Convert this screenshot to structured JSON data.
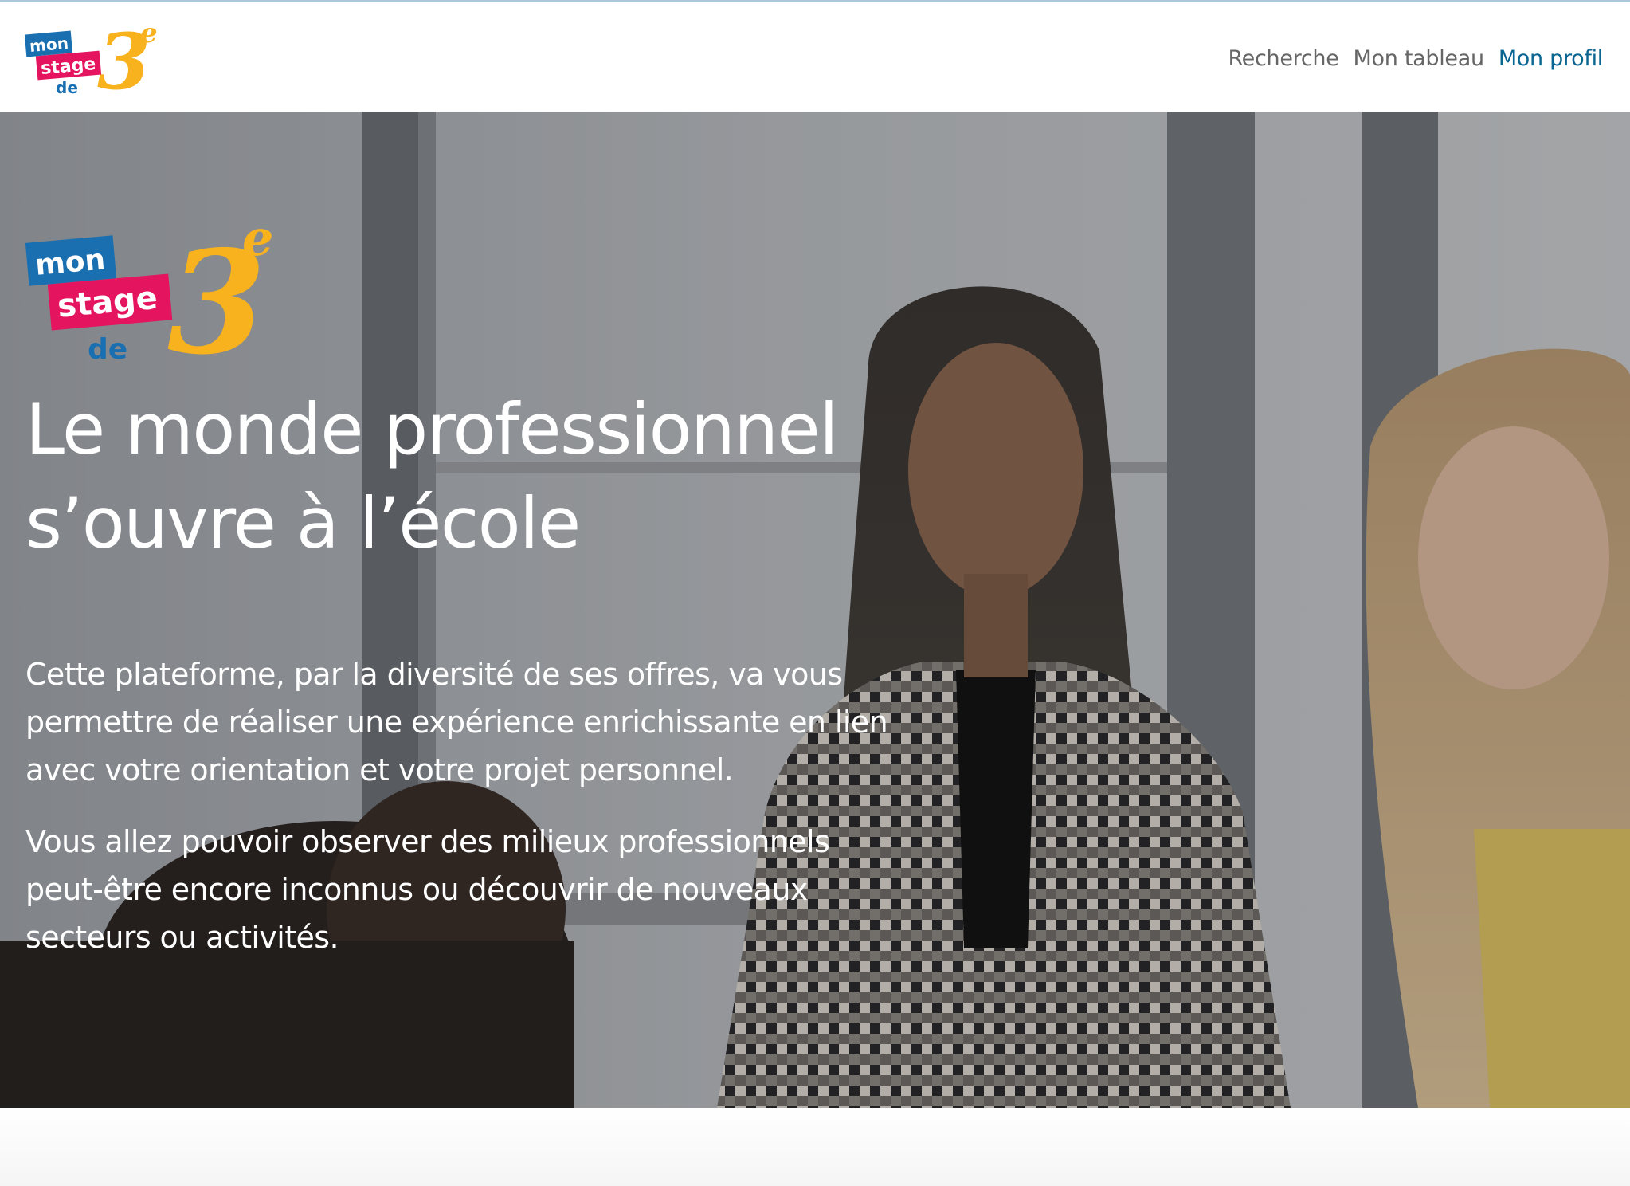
{
  "header": {
    "logo": {
      "line1": "mon",
      "line2": "stage",
      "line3": "de",
      "numeral": "3",
      "superscript": "e"
    },
    "nav": [
      {
        "label": "Recherche",
        "active": false
      },
      {
        "label": "Mon tableau",
        "active": false
      },
      {
        "label": "Mon profil",
        "active": true
      }
    ]
  },
  "hero": {
    "logo": {
      "line1": "mon",
      "line2": "stage",
      "line3": "de",
      "numeral": "3",
      "superscript": "e"
    },
    "title_lines": [
      "Le monde professionnel",
      "s’ouvre à l’école"
    ],
    "paragraph1_lines": [
      "Cette plateforme, par la diversité de ses offres, va vous",
      "permettre de réaliser une expérience enrichissante en lien",
      "avec votre orientation et votre projet personnel."
    ],
    "paragraph2_lines": [
      "Vous allez pouvoir observer des milieux professionnels",
      "peut-être encore inconnus ou découvrir de nouveaux",
      "secteurs ou activités."
    ]
  },
  "colors": {
    "logo_blue": "#1a6fb0",
    "logo_pink": "#e4145f",
    "logo_yellow": "#f7b21e",
    "nav_text": "#666666",
    "nav_active": "#0a6591",
    "hero_text": "#ffffff"
  }
}
